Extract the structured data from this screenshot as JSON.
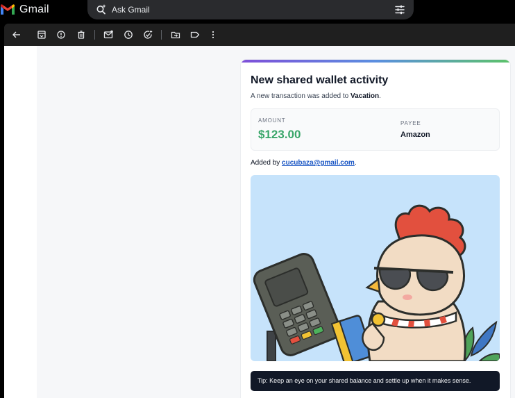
{
  "app": {
    "name": "Gmail",
    "brand_colors": [
      "#4285f4",
      "#ea4335",
      "#fbbc04",
      "#34a853"
    ]
  },
  "search": {
    "placeholder": "Ask Gmail"
  },
  "toolbar": {
    "icons": [
      "back-arrow-icon",
      "archive-icon",
      "report-spam-icon",
      "delete-icon",
      "mark-unread-icon",
      "snooze-icon",
      "add-task-icon",
      "move-to-icon",
      "label-icon",
      "more-options-icon"
    ]
  },
  "email": {
    "title": "New shared wallet activity",
    "subtitle_prefix": "A new transaction was added to ",
    "wallet_name": "Vacation",
    "subtitle_suffix": ".",
    "amount_label": "AMOUNT",
    "amount_value": "$123.00",
    "payee_label": "PAYEE",
    "payee_value": "Amazon",
    "added_by_prefix": "Added by ",
    "added_by_email": "cucubaza@gmail.com",
    "added_by_suffix": ".",
    "tip": "Tip: Keep an eye on your shared balance and settle up when it makes sense.",
    "accent_colors": [
      "#7e4fd9",
      "#5b8fe0",
      "#5cc26a"
    ],
    "amount_color": "#3aa66a"
  }
}
